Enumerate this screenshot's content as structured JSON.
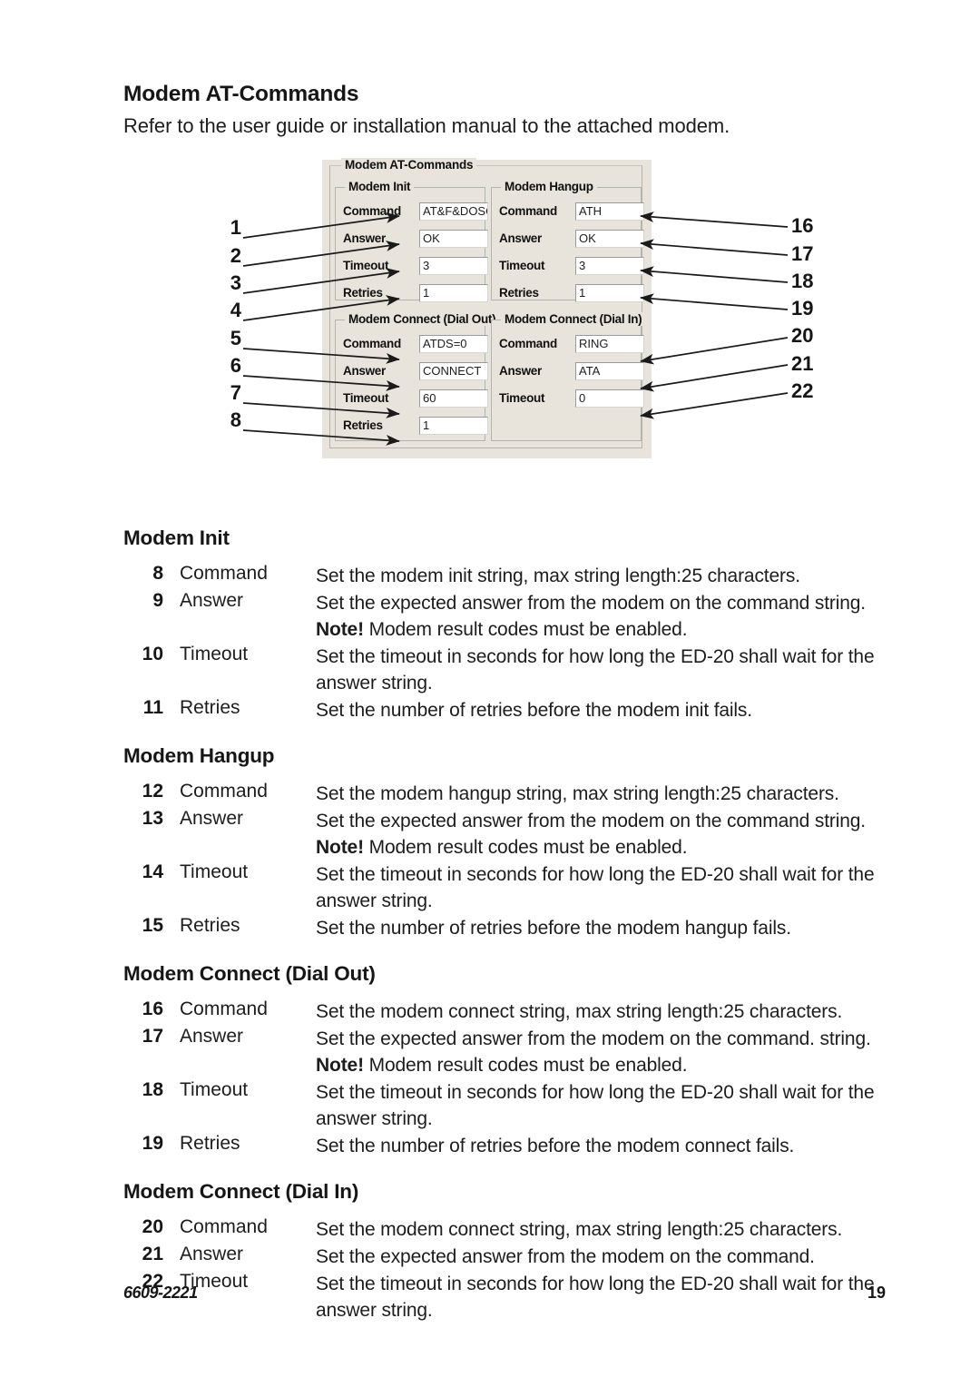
{
  "page": {
    "title": "Modem AT-Commands",
    "intro": "Refer to the user guide or installation manual to the attached modem.",
    "footer_doc": "6609-2221",
    "footer_page": "19"
  },
  "dialog": {
    "group_title": "Modem AT-Commands",
    "panels": [
      {
        "title": "Modem Init",
        "fields": [
          {
            "label": "Command",
            "value": "AT&F&DOSO"
          },
          {
            "label": "Answer",
            "value": "OK"
          },
          {
            "label": "Timeout",
            "value": "3"
          },
          {
            "label": "Retries",
            "value": "1"
          }
        ]
      },
      {
        "title": "Modem Hangup",
        "fields": [
          {
            "label": "Command",
            "value": "ATH"
          },
          {
            "label": "Answer",
            "value": "OK"
          },
          {
            "label": "Timeout",
            "value": "3"
          },
          {
            "label": "Retries",
            "value": "1"
          }
        ]
      },
      {
        "title": "Modem Connect (Dial Out)",
        "fields": [
          {
            "label": "Command",
            "value": "ATDS=0"
          },
          {
            "label": "Answer",
            "value": "CONNECT"
          },
          {
            "label": "Timeout",
            "value": "60"
          },
          {
            "label": "Retries",
            "value": "1"
          }
        ]
      },
      {
        "title": "Modem Connect (Dial In)",
        "fields": [
          {
            "label": "Command",
            "value": "RING"
          },
          {
            "label": "Answer",
            "value": "ATA"
          },
          {
            "label": "Timeout",
            "value": "0"
          }
        ]
      }
    ]
  },
  "callouts": {
    "left": [
      "1",
      "2",
      "3",
      "4",
      "5",
      "6",
      "7",
      "8"
    ],
    "right": [
      "16",
      "17",
      "18",
      "19",
      "20",
      "21",
      "22"
    ]
  },
  "sections": [
    {
      "title": "Modem Init",
      "items": [
        {
          "num": "8",
          "name": "Command",
          "desc_html": "Set the modem init string, max string length:25 characters."
        },
        {
          "num": "9",
          "name": "Answer",
          "desc_html": "Set the expected answer from the modem on the command string. <b>Note!</b> Modem result codes must be enabled."
        },
        {
          "num": "10",
          "name": "Timeout",
          "desc_html": "Set the timeout in seconds for how long the ED-20 shall wait for the answer string."
        },
        {
          "num": "11",
          "name": "Retries",
          "desc_html": "Set the number of retries before the modem init fails."
        }
      ]
    },
    {
      "title": "Modem Hangup",
      "items": [
        {
          "num": "12",
          "name": "Command",
          "desc_html": "Set the modem hangup string, max string length:25 characters."
        },
        {
          "num": "13",
          "name": "Answer",
          "desc_html": "Set the expected answer from the modem on the command string. <b>Note!</b> Modem result codes must be enabled."
        },
        {
          "num": "14",
          "name": "Timeout",
          "desc_html": "Set the timeout in seconds for how long the ED-20 shall wait for the answer string."
        },
        {
          "num": "15",
          "name": "Retries",
          "desc_html": "Set the number of retries before the modem hangup fails."
        }
      ]
    },
    {
      "title": "Modem Connect (Dial Out)",
      "items": [
        {
          "num": "16",
          "name": "Command",
          "desc_html": "Set the modem connect string, max string length:25 characters."
        },
        {
          "num": "17",
          "name": "Answer",
          "desc_html": "Set the expected answer from the modem on the command. string. <b>Note!</b> Modem result codes must be enabled."
        },
        {
          "num": "18",
          "name": "Timeout",
          "desc_html": "Set the timeout in seconds for how long the ED-20 shall wait for the answer string."
        },
        {
          "num": "19",
          "name": "Retries",
          "desc_html": "Set the number of retries before the modem connect fails."
        }
      ]
    },
    {
      "title": "Modem Connect (Dial In)",
      "items": [
        {
          "num": "20",
          "name": "Command",
          "desc_html": "Set the modem connect string, max string length:25 characters."
        },
        {
          "num": "21",
          "name": "Answer",
          "desc_html": "Set the expected answer from the modem on the command."
        },
        {
          "num": "22",
          "name": "Timeout",
          "desc_html": "Set the timeout in seconds for how long the ED-20 shall wait for the answer string."
        }
      ]
    }
  ]
}
